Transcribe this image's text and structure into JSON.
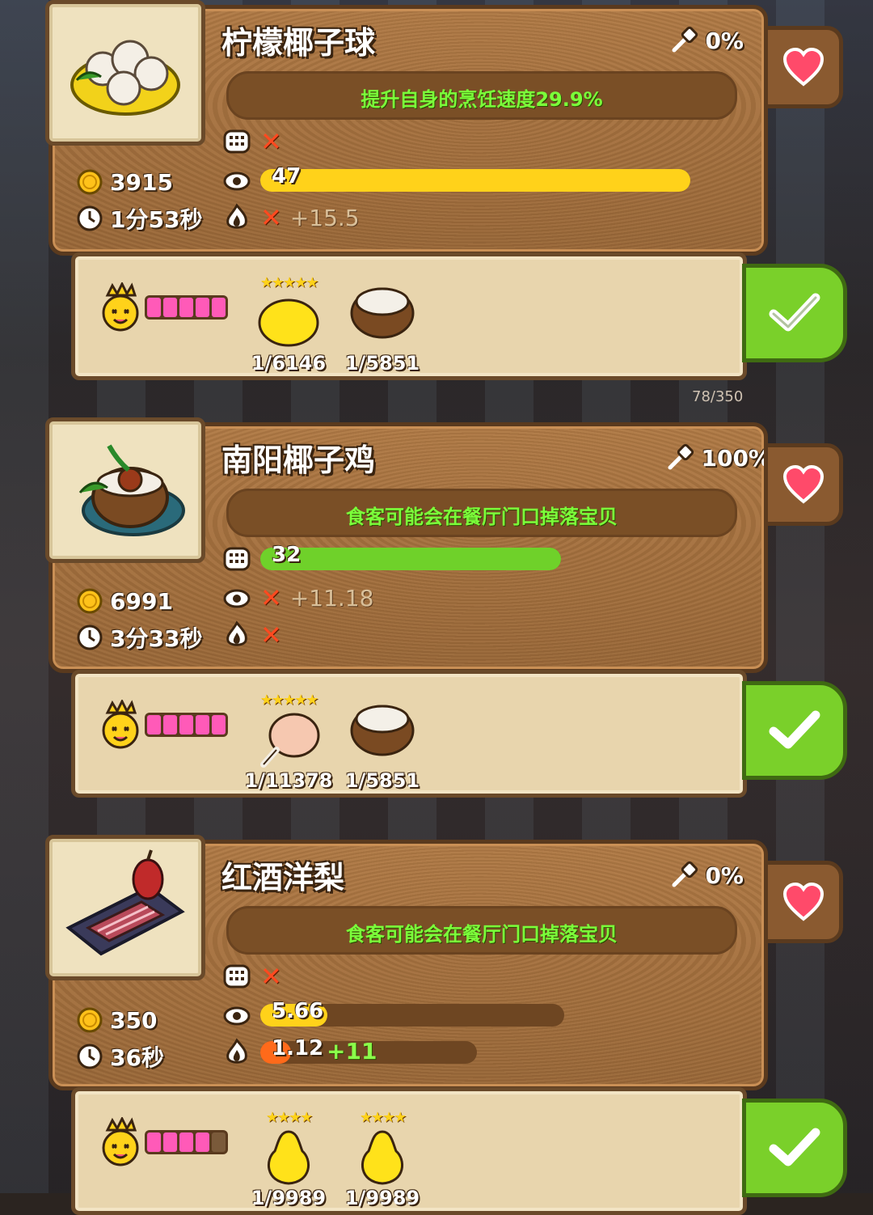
{
  "capacity_counter": "78/350",
  "recipes": [
    {
      "title": "柠檬椰子球",
      "percent": "0%",
      "effect": "提升自身的烹饪速度29.9%",
      "coins": "3915",
      "time": "1分53秒",
      "row1": {
        "type": "x"
      },
      "row2": {
        "type": "bar",
        "value": "47",
        "fill_fraction": 1.0,
        "color": "#ffd21a"
      },
      "row3": {
        "type": "x",
        "extra": "+15.5"
      },
      "chef_level": 5,
      "ingredients": [
        {
          "name": "lemon",
          "stars": "★★★★★",
          "count": "1/6146"
        },
        {
          "name": "coconut",
          "stars": "",
          "count": "1/5851"
        }
      ]
    },
    {
      "title": "南阳椰子鸡",
      "percent": "100%",
      "effect": "食客可能会在餐厅门口掉落宝贝",
      "coins": "6991",
      "time": "3分33秒",
      "row1": {
        "type": "bar",
        "value": "32",
        "fill_fraction": 1.0,
        "color": "#6fd12a"
      },
      "row2": {
        "type": "x",
        "extra": "+11.18"
      },
      "row3": {
        "type": "x"
      },
      "chef_level": 5,
      "ingredients": [
        {
          "name": "chicken-leg",
          "stars": "★★★★★",
          "count": "1/11378"
        },
        {
          "name": "coconut",
          "stars": "",
          "count": "1/5851"
        }
      ]
    },
    {
      "title": "红酒洋梨",
      "percent": "0%",
      "effect": "食客可能会在餐厅门口掉落宝贝",
      "coins": "350",
      "time": "36秒",
      "row1": {
        "type": "x"
      },
      "row2": {
        "type": "bar",
        "value": "5.66",
        "fill_fraction": 0.22,
        "color": "#ffd21a"
      },
      "row3": {
        "type": "bar",
        "value": "1.12",
        "fill_fraction": 0.09,
        "color": "#ff6a1a",
        "extra": "+11"
      },
      "chef_level": 4,
      "ingredients": [
        {
          "name": "pear",
          "stars": "★★★★",
          "count": "1/9989"
        },
        {
          "name": "pear",
          "stars": "★★★★",
          "count": "1/9989"
        }
      ]
    }
  ]
}
